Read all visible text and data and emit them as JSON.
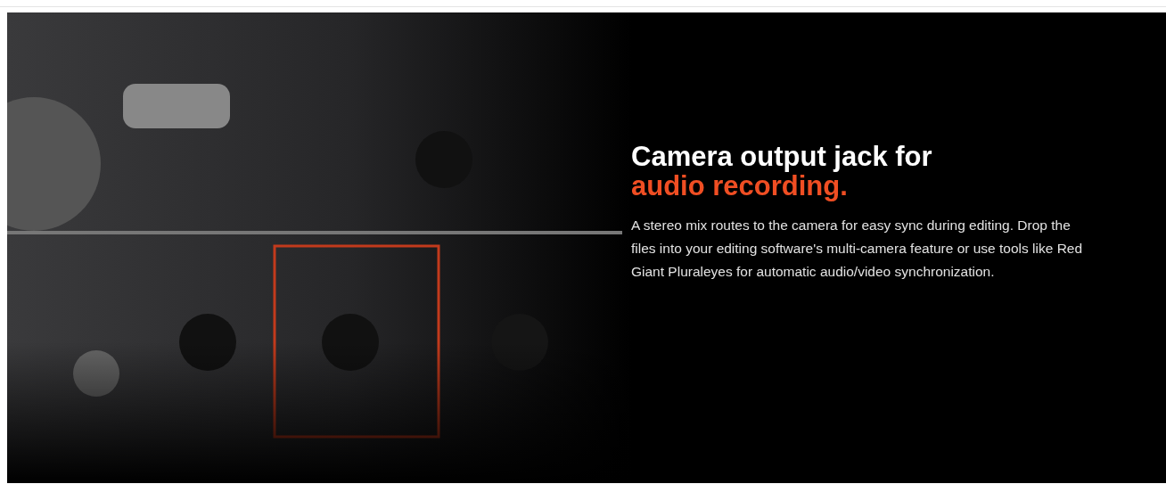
{
  "hero": {
    "heading": {
      "text": "Camera output jack for ",
      "highlight": "audio recording."
    },
    "body": "A stereo mix routes to the camera for easy sync during editing. Drop the files into your editing software's multi-camera feature or use tools like Red Giant Pluraleyes for automatic audio/video synchronization."
  }
}
